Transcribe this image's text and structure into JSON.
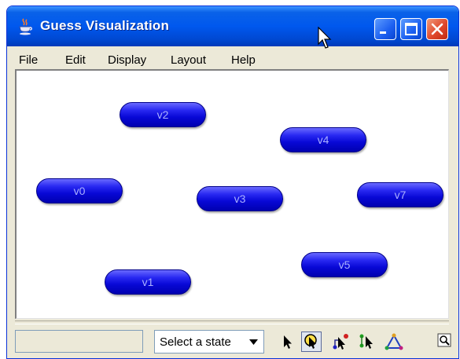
{
  "window": {
    "title": "Guess Visualization"
  },
  "menu": {
    "items": [
      "File",
      "Edit",
      "Display",
      "Layout",
      "Help"
    ]
  },
  "graph": {
    "nodes": [
      {
        "label": "v2"
      },
      {
        "label": "v4"
      },
      {
        "label": "v0"
      },
      {
        "label": "v3"
      },
      {
        "label": "v7"
      },
      {
        "label": "v5"
      },
      {
        "label": "v1"
      }
    ]
  },
  "statusbar": {
    "state_select": {
      "selected": "Select a state"
    }
  },
  "icons": {
    "app": "java-cup-icon",
    "minimize": "minimize-icon",
    "maximize": "maximize-icon",
    "close": "close-icon",
    "tools": [
      "pointer-icon",
      "zoom-select-icon",
      "node-drag-icon",
      "edge-select-icon",
      "layout-icon"
    ],
    "zoom": "zoom-fit-icon"
  },
  "colors": {
    "titlebar": "#0058ee",
    "node": "#0808d6",
    "close_button": "#e0482c"
  }
}
